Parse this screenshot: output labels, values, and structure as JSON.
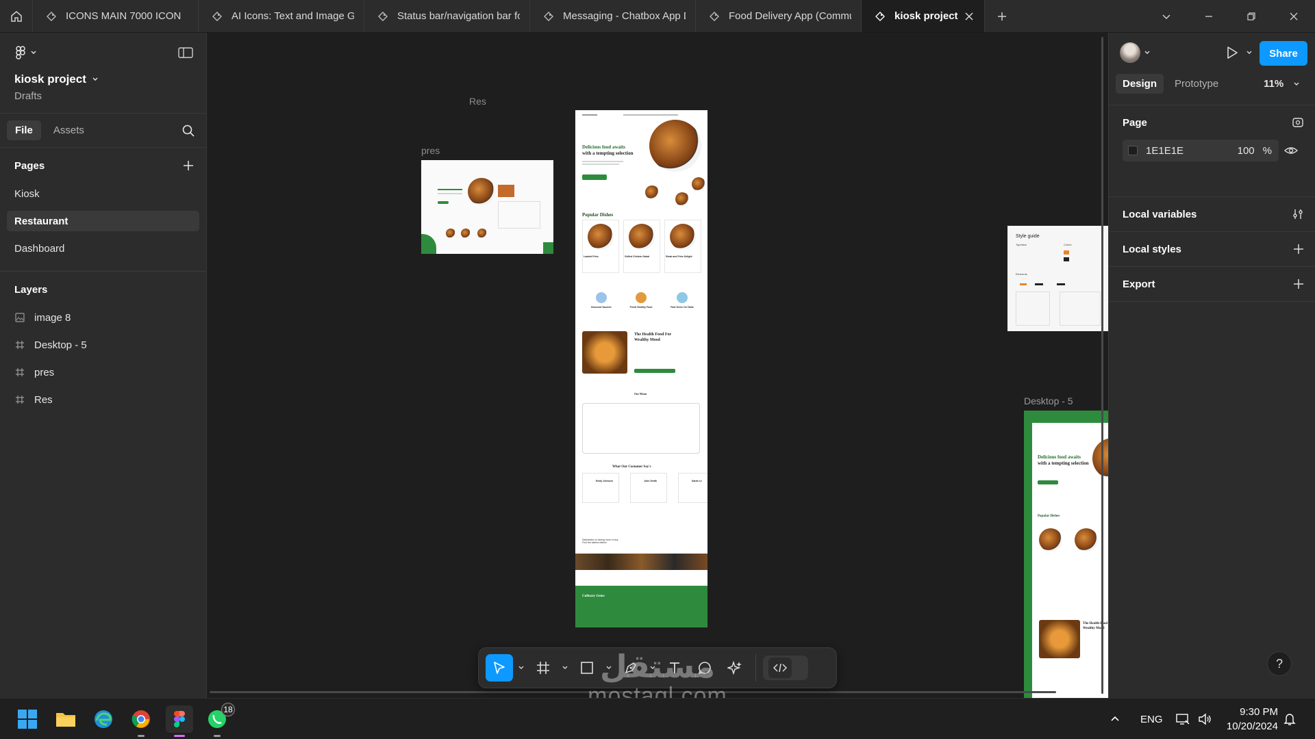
{
  "tabs": [
    {
      "title": "ICONS MAIN 7000 ICON"
    },
    {
      "title": "AI Icons: Text and Image Ge"
    },
    {
      "title": "Status bar/navigation bar fo"
    },
    {
      "title": "Messaging - Chatbox App D"
    },
    {
      "title": "Food Delivery App (Commu"
    },
    {
      "title": "kiosk project",
      "active": true
    }
  ],
  "left_panel": {
    "project_name": "kiosk project",
    "location": "Drafts",
    "tab_file": "File",
    "tab_assets": "Assets",
    "pages_heading": "Pages",
    "pages": [
      "Kiosk",
      "Restaurant",
      "Dashboard"
    ],
    "active_page": "Restaurant",
    "layers_heading": "Layers",
    "layers": [
      {
        "name": "image 8",
        "icon": "image-icon"
      },
      {
        "name": "Desktop - 5",
        "icon": "frame-icon"
      },
      {
        "name": "pres",
        "icon": "frame-icon"
      },
      {
        "name": "Res",
        "icon": "frame-icon"
      }
    ]
  },
  "canvas": {
    "frames": [
      {
        "label": "pres"
      },
      {
        "label": "Res"
      },
      {
        "label": "Desktop - 5"
      }
    ],
    "mockup": {
      "hero_title_1": "Delicious food awaits",
      "hero_title_2": "with a tempting selection",
      "popular": "Popular Dishes",
      "dishes": [
        "Loaded Fries",
        "Grilled Chicken Salad",
        "Steak and Fries Delight"
      ],
      "features": [
        "Discount Voucher",
        "Fresh Healthy Food",
        "Fast Serve On Table"
      ],
      "health_title_1": "The Health Food For",
      "health_title_2": "Wealthy Mood",
      "menu_title": "Our Menu",
      "testimonials": "What Our Customer Say's",
      "customers": [
        "Emily Johnson",
        "John Smith",
        "Sarah Le"
      ],
      "newsletter_1": "Satisfaction is having more of any",
      "newsletter_2": "Find the tastiest dishes",
      "footer_brand": "Culinary Gems",
      "style_guide": "Style guide",
      "typeface": "Typeface",
      "colors": "Colors",
      "elements": "Elements"
    }
  },
  "right_panel": {
    "share": "Share",
    "tab_design": "Design",
    "tab_prototype": "Prototype",
    "zoom": "11%",
    "page_heading": "Page",
    "page_color": "1E1E1E",
    "page_opacity": "100",
    "percent": "%",
    "local_variables": "Local variables",
    "local_styles": "Local styles",
    "export": "Export"
  },
  "help": "?",
  "taskbar": {
    "whatsapp_badge": "18",
    "language": "ENG",
    "time": "9:30 PM",
    "date": "10/20/2024"
  },
  "watermark": {
    "arabic": "مستقل",
    "latin": "mostaql.com"
  },
  "colors": {
    "accent": "#0d99ff",
    "canvas_bg": "#1e1e1e",
    "panel_bg": "#2c2c2c",
    "brand_green": "#2e8b3e"
  }
}
